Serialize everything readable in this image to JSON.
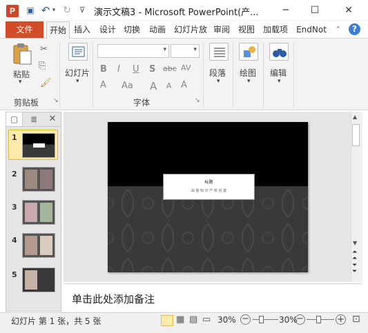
{
  "window": {
    "title": "演示文稿3 - Microsoft PowerPoint(产...",
    "app_icon": "P",
    "minimize": "─",
    "maximize": "☐",
    "close": "✕"
  },
  "quick_access": {
    "save_icon": "▣",
    "undo_icon": "↶",
    "undo_dropdown": "▾",
    "redo_icon": "↻",
    "customize": "⊽"
  },
  "tabs": {
    "file": "文件",
    "items": [
      "开始",
      "插入",
      "设计",
      "切换",
      "动画",
      "幻灯片放",
      "审阅",
      "视图",
      "加载项",
      "EndNot"
    ],
    "collapse": "⌃",
    "help": "?"
  },
  "ribbon": {
    "clipboard": {
      "paste": "粘贴",
      "paste_arrow": "▾",
      "label": "剪贴板",
      "launcher": "↘"
    },
    "slides": {
      "label": "幻灯片",
      "arrow": "▾"
    },
    "font": {
      "label": "字体",
      "launcher": "↘",
      "bold": "B",
      "italic": "I",
      "underline": "U",
      "shadow": "S",
      "strike": "abc",
      "spacing": "AV",
      "font_color": "A",
      "case": "Aa",
      "grow": "A",
      "shrink": "A",
      "clear": "A"
    },
    "paragraph": {
      "label": "段落",
      "arrow": "▾"
    },
    "drawing": {
      "label": "绘图",
      "arrow": "▾"
    },
    "editing": {
      "label": "编辑",
      "arrow": "▾"
    }
  },
  "panel": {
    "close": "✕",
    "slide_numbers": [
      "1",
      "2",
      "3",
      "4",
      "5"
    ]
  },
  "slide": {
    "title": "标题",
    "subtitle": "由 整 知 识 产 权 创 建"
  },
  "notes": {
    "placeholder": "单击此处添加备注"
  },
  "status": {
    "slide_info": "幻灯片 第 1 张，共 5 张",
    "zoom": "30%",
    "zoom2": "30%",
    "minus": "−",
    "plus": "+",
    "fit": "⊡"
  },
  "colors": {
    "file_tab": "#d24c2b",
    "accent": "#3b7dd8"
  }
}
